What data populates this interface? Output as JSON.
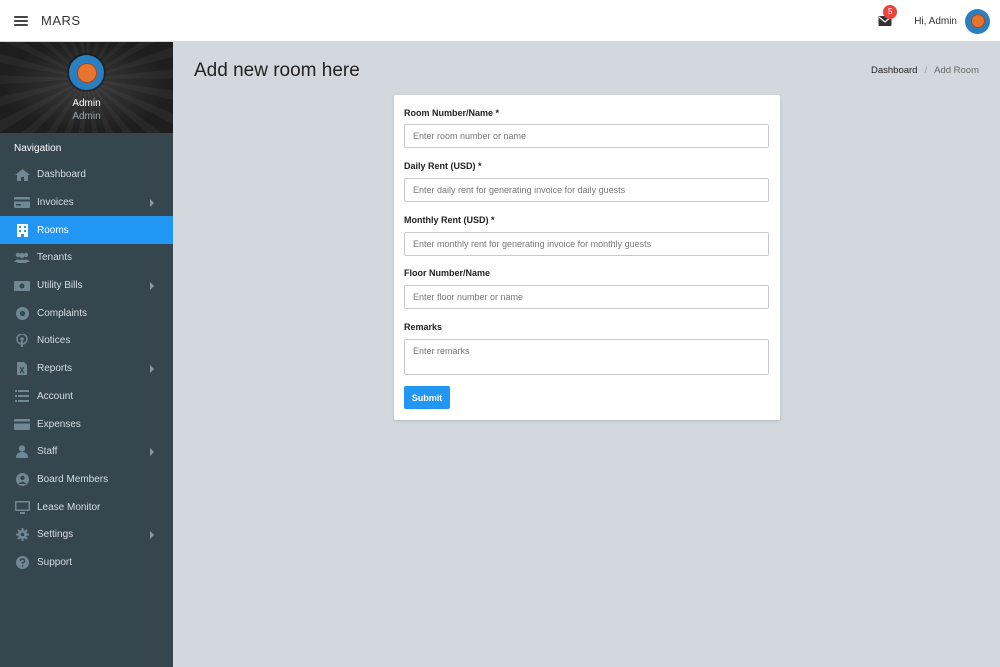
{
  "app": {
    "title": "MARS"
  },
  "header": {
    "notification_count": "5",
    "greeting": "Hi, Admin"
  },
  "profile": {
    "name": "Admin",
    "role": "Admin"
  },
  "sidebar": {
    "heading": "Navigation",
    "items": [
      {
        "label": "Dashboard",
        "icon": "home-icon"
      },
      {
        "label": "Invoices",
        "icon": "credit-card-icon"
      },
      {
        "label": "Rooms",
        "icon": "building-icon"
      },
      {
        "label": "Tenants",
        "icon": "users-icon"
      },
      {
        "label": "Utility Bills",
        "icon": "money-bill-icon"
      },
      {
        "label": "Complaints",
        "icon": "lifebuoy-icon"
      },
      {
        "label": "Notices",
        "icon": "podcast-icon"
      },
      {
        "label": "Reports",
        "icon": "file-report-icon"
      },
      {
        "label": "Account",
        "icon": "list-icon"
      },
      {
        "label": "Expenses",
        "icon": "card-icon"
      },
      {
        "label": "Staff",
        "icon": "user-icon"
      },
      {
        "label": "Board Members",
        "icon": "user-circle-icon"
      },
      {
        "label": "Lease Monitor",
        "icon": "monitor-icon"
      },
      {
        "label": "Settings",
        "icon": "gear-icon"
      },
      {
        "label": "Support",
        "icon": "question-icon"
      }
    ]
  },
  "page": {
    "title": "Add new room here",
    "breadcrumb": {
      "link": "Dashboard",
      "current": "Add Room"
    }
  },
  "form": {
    "room": {
      "label": "Room Number/Name *",
      "placeholder": "Enter room number or name"
    },
    "daily_rent": {
      "label": "Daily Rent (USD) *",
      "placeholder": "Enter daily rent for generating invoice for daily guests"
    },
    "monthly_rent": {
      "label": "Monthly Rent (USD) *",
      "placeholder": "Enter monthly rent for generating invoice for monthly guests"
    },
    "floor": {
      "label": "Floor Number/Name",
      "placeholder": "Enter floor number or name"
    },
    "remarks": {
      "label": "Remarks",
      "placeholder": "Enter remarks"
    },
    "submit_label": "Submit"
  },
  "colors": {
    "accent": "#2196f3",
    "sidebar": "#35464f",
    "background": "#d2d8dd",
    "badge": "#e8453c"
  }
}
